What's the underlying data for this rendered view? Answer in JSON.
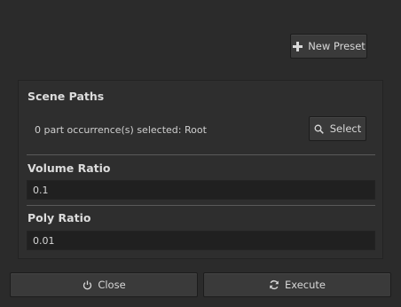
{
  "toolbar": {
    "new_preset_label": "New Preset",
    "new_preset_icon": "plus-icon"
  },
  "scene_paths": {
    "title": "Scene Paths",
    "status": "0 part occurrence(s) selected: Root",
    "select_label": "Select",
    "select_icon": "search-icon"
  },
  "volume_ratio": {
    "title": "Volume Ratio",
    "value": "0.1"
  },
  "poly_ratio": {
    "title": "Poly Ratio",
    "value": "0.01"
  },
  "footer": {
    "close_label": "Close",
    "close_icon": "power-icon",
    "execute_label": "Execute",
    "execute_icon": "refresh-icon"
  },
  "colors": {
    "background": "#2b2b2b",
    "panel": "#2e2e2e",
    "button": "#3a3a3a",
    "field": "#202020",
    "text": "#d6d6d6"
  }
}
